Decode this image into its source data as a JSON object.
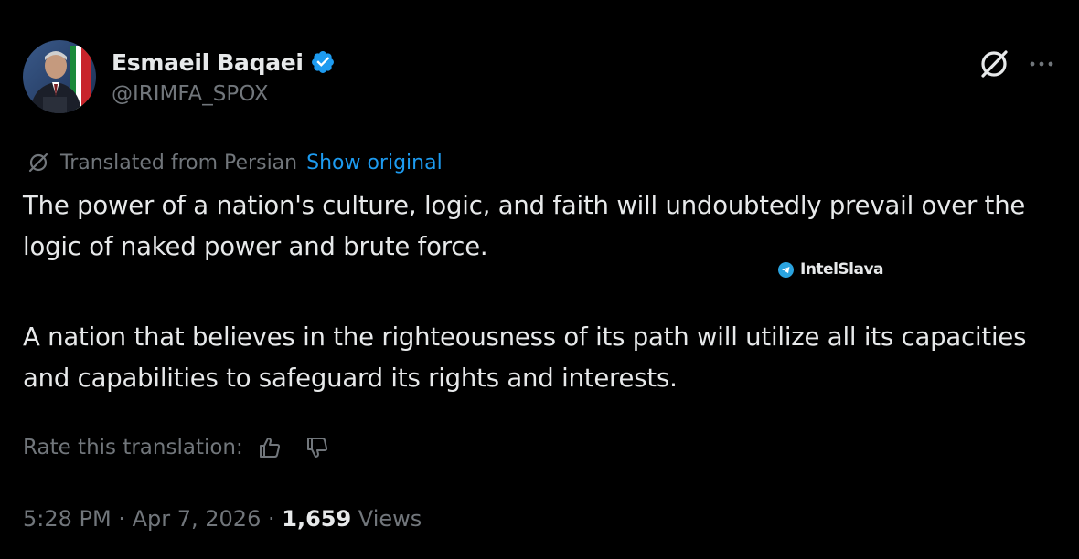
{
  "author": {
    "name": "Esmaeil Baqaei",
    "handle": "@IRIMFA_SPOX",
    "verified": true
  },
  "icons": {
    "verified": "verified-badge-icon",
    "grok": "grok-icon",
    "more": "more-icon",
    "translated": "grok-icon",
    "thumbs_up": "thumbs-up-icon",
    "thumbs_down": "thumbs-down-icon",
    "telegram": "telegram-icon"
  },
  "translation": {
    "label": "Translated from Persian",
    "show_original": "Show original"
  },
  "tweet": {
    "paragraphs": [
      "The power of a nation's culture, logic, and faith will undoubtedly prevail over the logic of naked power and brute force.",
      "A nation that believes in the righteousness of its path will utilize all its capacities and capabilities to safeguard its rights and interests."
    ]
  },
  "watermark": {
    "text": "IntelSlava"
  },
  "rate": {
    "label": "Rate this translation:"
  },
  "meta": {
    "time": "5:28 PM",
    "sep1": " · ",
    "date": "Apr 7, 2026",
    "sep2": " · ",
    "views_count": "1,659",
    "views_label": " Views"
  },
  "colors": {
    "background": "#000000",
    "text": "#e7e9ea",
    "secondary": "#71767b",
    "link": "#1d9bf0",
    "verified": "#1d9bf0"
  }
}
